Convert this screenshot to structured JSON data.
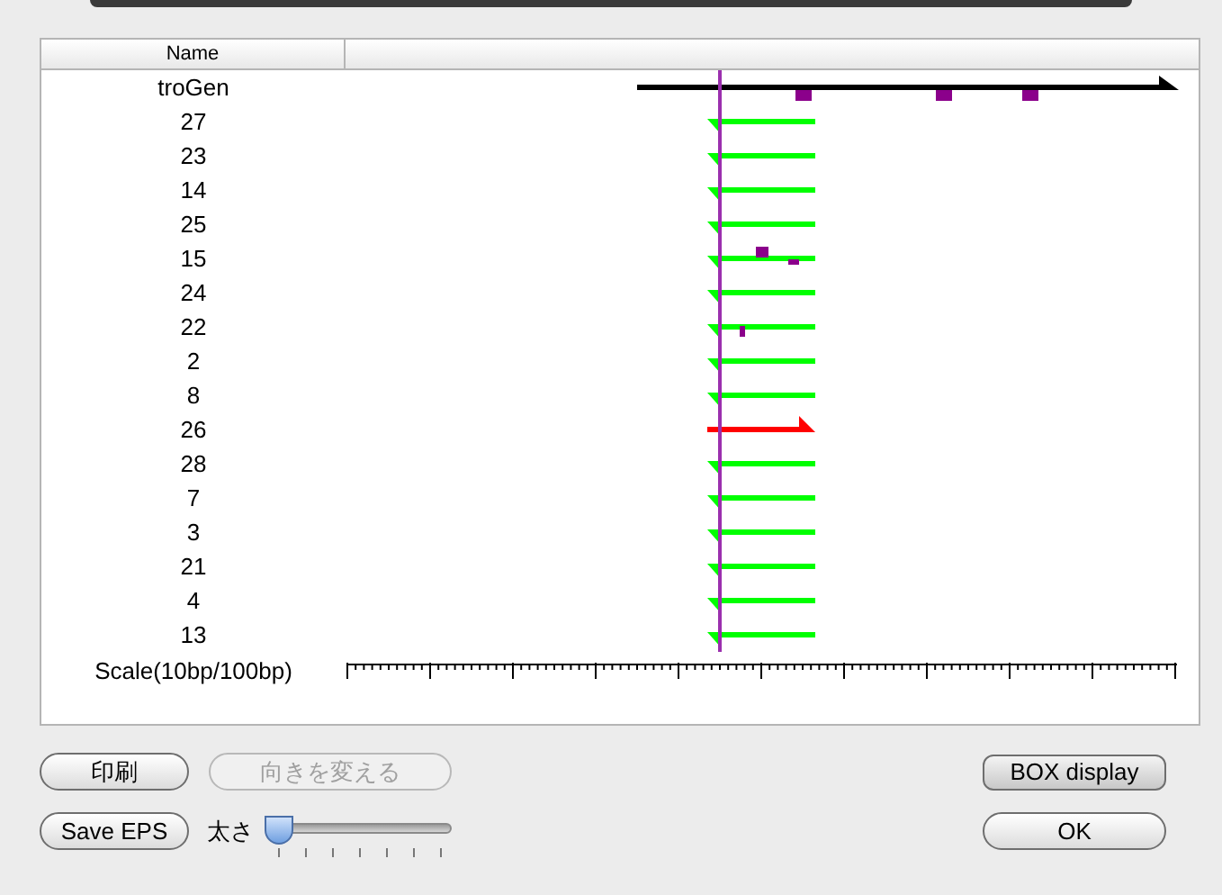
{
  "table": {
    "columns": [
      "Name"
    ],
    "rows": [
      {
        "name": "troGen",
        "kind": "reference",
        "color": "#000000"
      },
      {
        "name": "27",
        "kind": "reverse",
        "color": "#00ff00"
      },
      {
        "name": "23",
        "kind": "reverse",
        "color": "#00ff00"
      },
      {
        "name": "14",
        "kind": "reverse",
        "color": "#00ff00"
      },
      {
        "name": "25",
        "kind": "reverse",
        "color": "#00ff00"
      },
      {
        "name": "15",
        "kind": "reverse",
        "color": "#00ff00"
      },
      {
        "name": "24",
        "kind": "reverse",
        "color": "#00ff00"
      },
      {
        "name": "22",
        "kind": "reverse",
        "color": "#00ff00"
      },
      {
        "name": "2",
        "kind": "reverse",
        "color": "#00ff00"
      },
      {
        "name": "8",
        "kind": "reverse",
        "color": "#00ff00"
      },
      {
        "name": "26",
        "kind": "forward",
        "color": "#ff0000"
      },
      {
        "name": "28",
        "kind": "reverse",
        "color": "#00ff00"
      },
      {
        "name": "7",
        "kind": "reverse",
        "color": "#00ff00"
      },
      {
        "name": "3",
        "kind": "reverse",
        "color": "#00ff00"
      },
      {
        "name": "21",
        "kind": "reverse",
        "color": "#00ff00"
      },
      {
        "name": "4",
        "kind": "reverse",
        "color": "#00ff00"
      },
      {
        "name": "13",
        "kind": "reverse",
        "color": "#00ff00"
      }
    ],
    "scale_label": "Scale(10bp/100bp)"
  },
  "buttons": [
    {
      "label": "印刷",
      "disabled": false
    },
    {
      "label": "向きを変える",
      "disabled": true
    },
    {
      "label": "BOX display",
      "disabled": false
    },
    {
      "label": "Save EPS",
      "disabled": false
    },
    {
      "label": "OK",
      "disabled": false
    }
  ],
  "thickness": {
    "label": "太さ",
    "level": 0
  }
}
